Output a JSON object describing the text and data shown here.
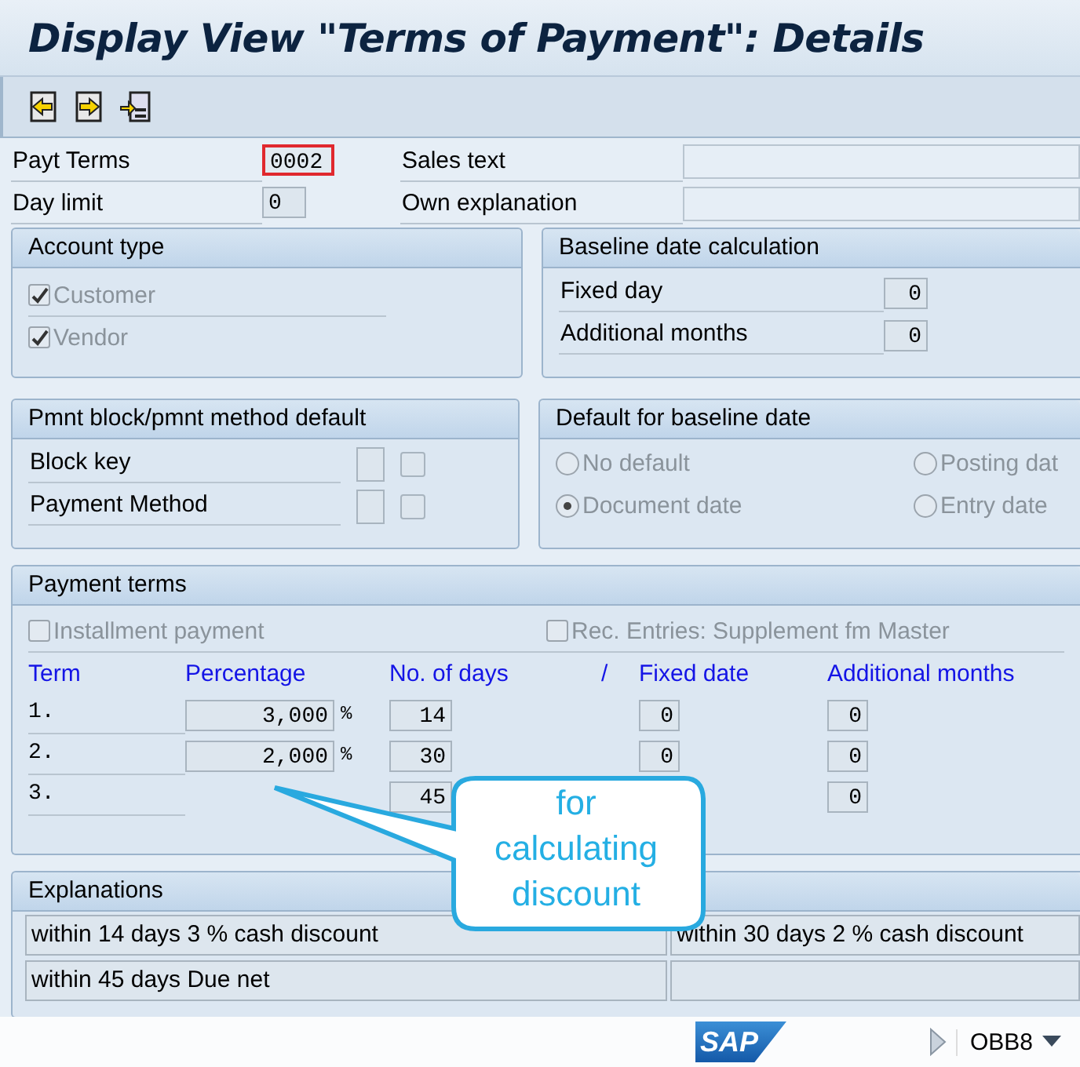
{
  "window": {
    "title": "Display View \"Terms of Payment\": Details"
  },
  "toolbar": {
    "buttons": [
      {
        "kind": "previous"
      },
      {
        "kind": "next"
      },
      {
        "kind": "other"
      }
    ]
  },
  "header": {
    "payt_terms": {
      "label": "Payt Terms",
      "value": "0002",
      "focused": true
    },
    "day_limit": {
      "label": "Day limit",
      "value": "0"
    },
    "sales_text": {
      "label": "Sales text"
    },
    "own_explanation": {
      "label": "Own explanation"
    }
  },
  "account_type": {
    "title": "Account type",
    "checkboxes": [
      {
        "label": "Customer",
        "checked": true,
        "disabled": true
      },
      {
        "label": "Vendor",
        "checked": true,
        "disabled": true
      }
    ]
  },
  "baseline_date_calculation": {
    "title": "Baseline date calculation",
    "fields": [
      {
        "label": "Fixed day",
        "value": "0"
      },
      {
        "label": "Additional months",
        "value": "0"
      }
    ]
  },
  "pmnt_block": {
    "title": "Pmnt block/pmnt method default",
    "rows": [
      {
        "label": "Block key",
        "checked": false
      },
      {
        "label": "Payment Method",
        "checked": false
      }
    ]
  },
  "default_for_baseline_date": {
    "title": "Default for baseline date",
    "radios": [
      {
        "label": "No default",
        "selected": false
      },
      {
        "label": "Posting dat",
        "selected": false
      },
      {
        "label": "Document date",
        "selected": true
      },
      {
        "label": "Entry date",
        "selected": false
      }
    ]
  },
  "payment_terms": {
    "title": "Payment terms",
    "checkboxes": [
      {
        "label": "Installment payment",
        "checked": false
      },
      {
        "label": "Rec. Entries: Supplement fm Master",
        "checked": false
      }
    ],
    "columns": [
      "Term",
      "Percentage",
      "No. of days",
      "/",
      "Fixed date",
      "Additional months"
    ],
    "rows": [
      {
        "term": "1.",
        "percentage": "3,000",
        "unit": "%",
        "days": "14",
        "fixed_date": "0",
        "additional_months": "0"
      },
      {
        "term": "2.",
        "percentage": "2,000",
        "unit": "%",
        "days": "30",
        "fixed_date": "0",
        "additional_months": "0"
      },
      {
        "term": "3.",
        "days": "45",
        "additional_months": "0"
      }
    ]
  },
  "explanations": {
    "title": "Explanations",
    "rows": [
      [
        "within 14 days 3 % cash discount",
        "within 30 days 2 % cash discount"
      ],
      [
        "within 45 days Due net"
      ]
    ]
  },
  "callout": {
    "text": "for calculating discount"
  },
  "status_bar": {
    "logo": "SAP",
    "transaction": "OBB8"
  }
}
